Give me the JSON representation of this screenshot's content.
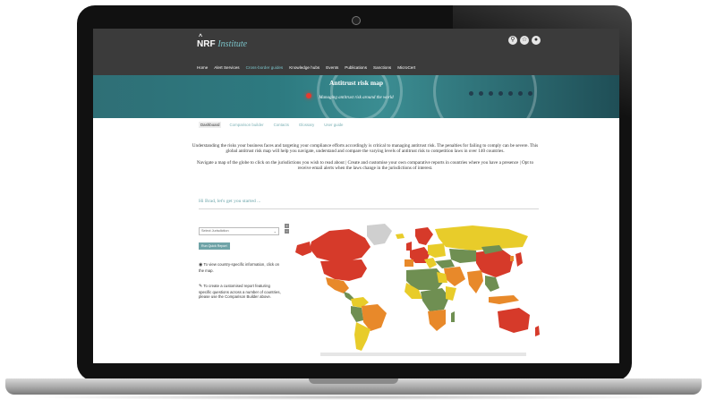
{
  "site": {
    "logo_brand": "NRF",
    "logo_institute": "Institute"
  },
  "topbar_icons": [
    "search-icon",
    "star-icon",
    "user-icon"
  ],
  "nav": {
    "items": [
      {
        "label": "Home",
        "active": false
      },
      {
        "label": "Alert Services",
        "active": false
      },
      {
        "label": "Cross-border guides",
        "active": true
      },
      {
        "label": "Knowledge hubs",
        "active": false
      },
      {
        "label": "Events",
        "active": false
      },
      {
        "label": "Publications",
        "active": false
      },
      {
        "label": "Sanctions",
        "active": false
      },
      {
        "label": "MicroCert",
        "active": false
      }
    ]
  },
  "hero": {
    "title": "Antitrust risk map",
    "subtitle": "Managing antitrust risk around the world"
  },
  "subtabs": [
    {
      "label": "Dashboard",
      "active": true
    },
    {
      "label": "Comparison builder",
      "active": false
    },
    {
      "label": "Contacts",
      "active": false
    },
    {
      "label": "Glossary",
      "active": false
    },
    {
      "label": "User guide",
      "active": false
    }
  ],
  "intro": {
    "p1": "Understanding the risks your business faces and targeting your compliance efforts accordingly is critical to managing antitrust risk. The penalties for failing to comply can be severe. This global antitrust risk map will  help you navigate, understand and compare the varying levels of antitrust risk to competition laws in over 140 countries.",
    "p2": "Navigate a map of the globe to click on the jurisdictions you wish to read about | Create and customise your own comparative reports in countries where you have a presence | Opt to receive email alerts when the laws change in the jurisdictions of interest."
  },
  "greeting": "Hi Brad, let's get you started ...",
  "controls": {
    "select_value": "Select Jurisdiction",
    "button_label": "Run Quick Report",
    "note1": "To view country-specific information, click on the map.",
    "note2": "To create a customised report featuring specific questions across a number of countries, please use the Comparison Builder above."
  },
  "map": {
    "zoom_in": "+",
    "zoom_out": "−",
    "risk_colors": {
      "high": "#d63a2a",
      "elevated": "#e8892a",
      "moderate": "#e8cc2a",
      "low": "#6f8f52",
      "no_data": "#cfcfcf"
    }
  }
}
